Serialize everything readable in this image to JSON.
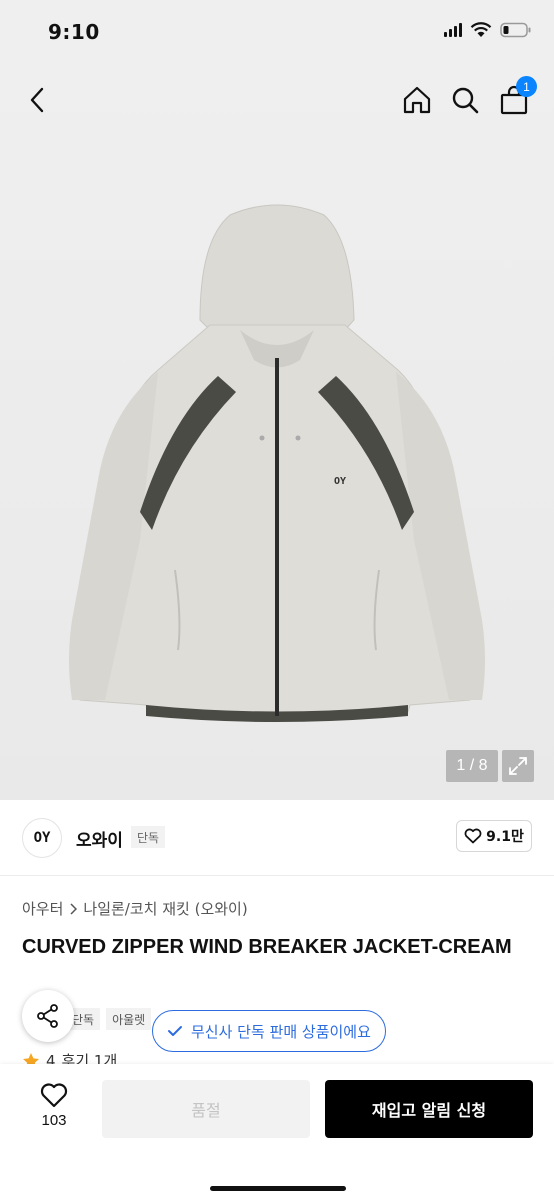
{
  "status": {
    "time": "9:10"
  },
  "nav": {
    "cart_count": "1"
  },
  "gallery": {
    "pager": "1 / 8"
  },
  "product_image": {
    "chest_logo": "OY"
  },
  "brand": {
    "logo_text": "OY",
    "name": "오와이",
    "tag": "단독",
    "likes": "9.1만"
  },
  "product": {
    "breadcrumb": [
      "아우터",
      "나일론/코치 재킷 (오와이)"
    ],
    "title": "CURVED ZIPPER WIND BREAKER JACKET-CREAM",
    "tags": [
      "단독",
      "아울렛"
    ],
    "exclusive_badge": "무신사 단독 판매 상품이에요",
    "rating": "4",
    "review_text": "후기 1개"
  },
  "bottom": {
    "wish_count": "103",
    "soldout_label": "품절",
    "restock_label": "재입고 알림 신청"
  },
  "colors": {
    "accent": "#2d6cdf",
    "badge": "#0a84ff",
    "rating": "#f5a623"
  }
}
